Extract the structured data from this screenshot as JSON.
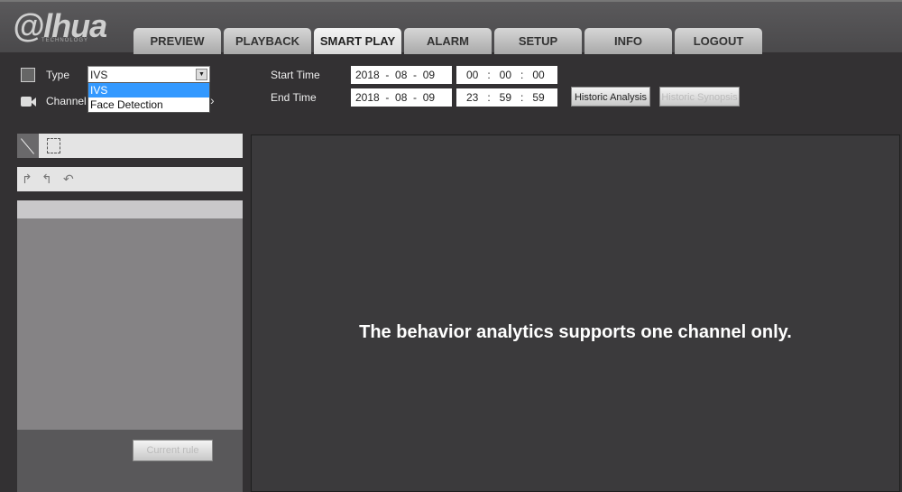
{
  "brand": {
    "logo": "alhua",
    "tagline": "TECHNOLOGY"
  },
  "tabs": [
    {
      "label": "PREVIEW"
    },
    {
      "label": "PLAYBACK"
    },
    {
      "label": "SMART PLAY",
      "active": true
    },
    {
      "label": "ALARM"
    },
    {
      "label": "SETUP"
    },
    {
      "label": "INFO"
    },
    {
      "label": "LOGOUT"
    }
  ],
  "filters": {
    "type_label": "Type",
    "type_value": "IVS",
    "type_options": [
      "IVS",
      "Face Detection"
    ],
    "channel_label": "Channel",
    "start_label": "Start Time",
    "start_date": "2018  -  08  -  09",
    "start_time": "00   :   00   :   00",
    "end_label": "End Time",
    "end_date": "2018  -  08  -  09",
    "end_time": "23   :   59   :   59",
    "historic_analysis": "Historic Analysis",
    "historic_synopsis": "Historic Synopsis"
  },
  "left_panel": {
    "current_rule": "Current rule"
  },
  "video": {
    "message": "The behavior analytics supports one channel only."
  }
}
